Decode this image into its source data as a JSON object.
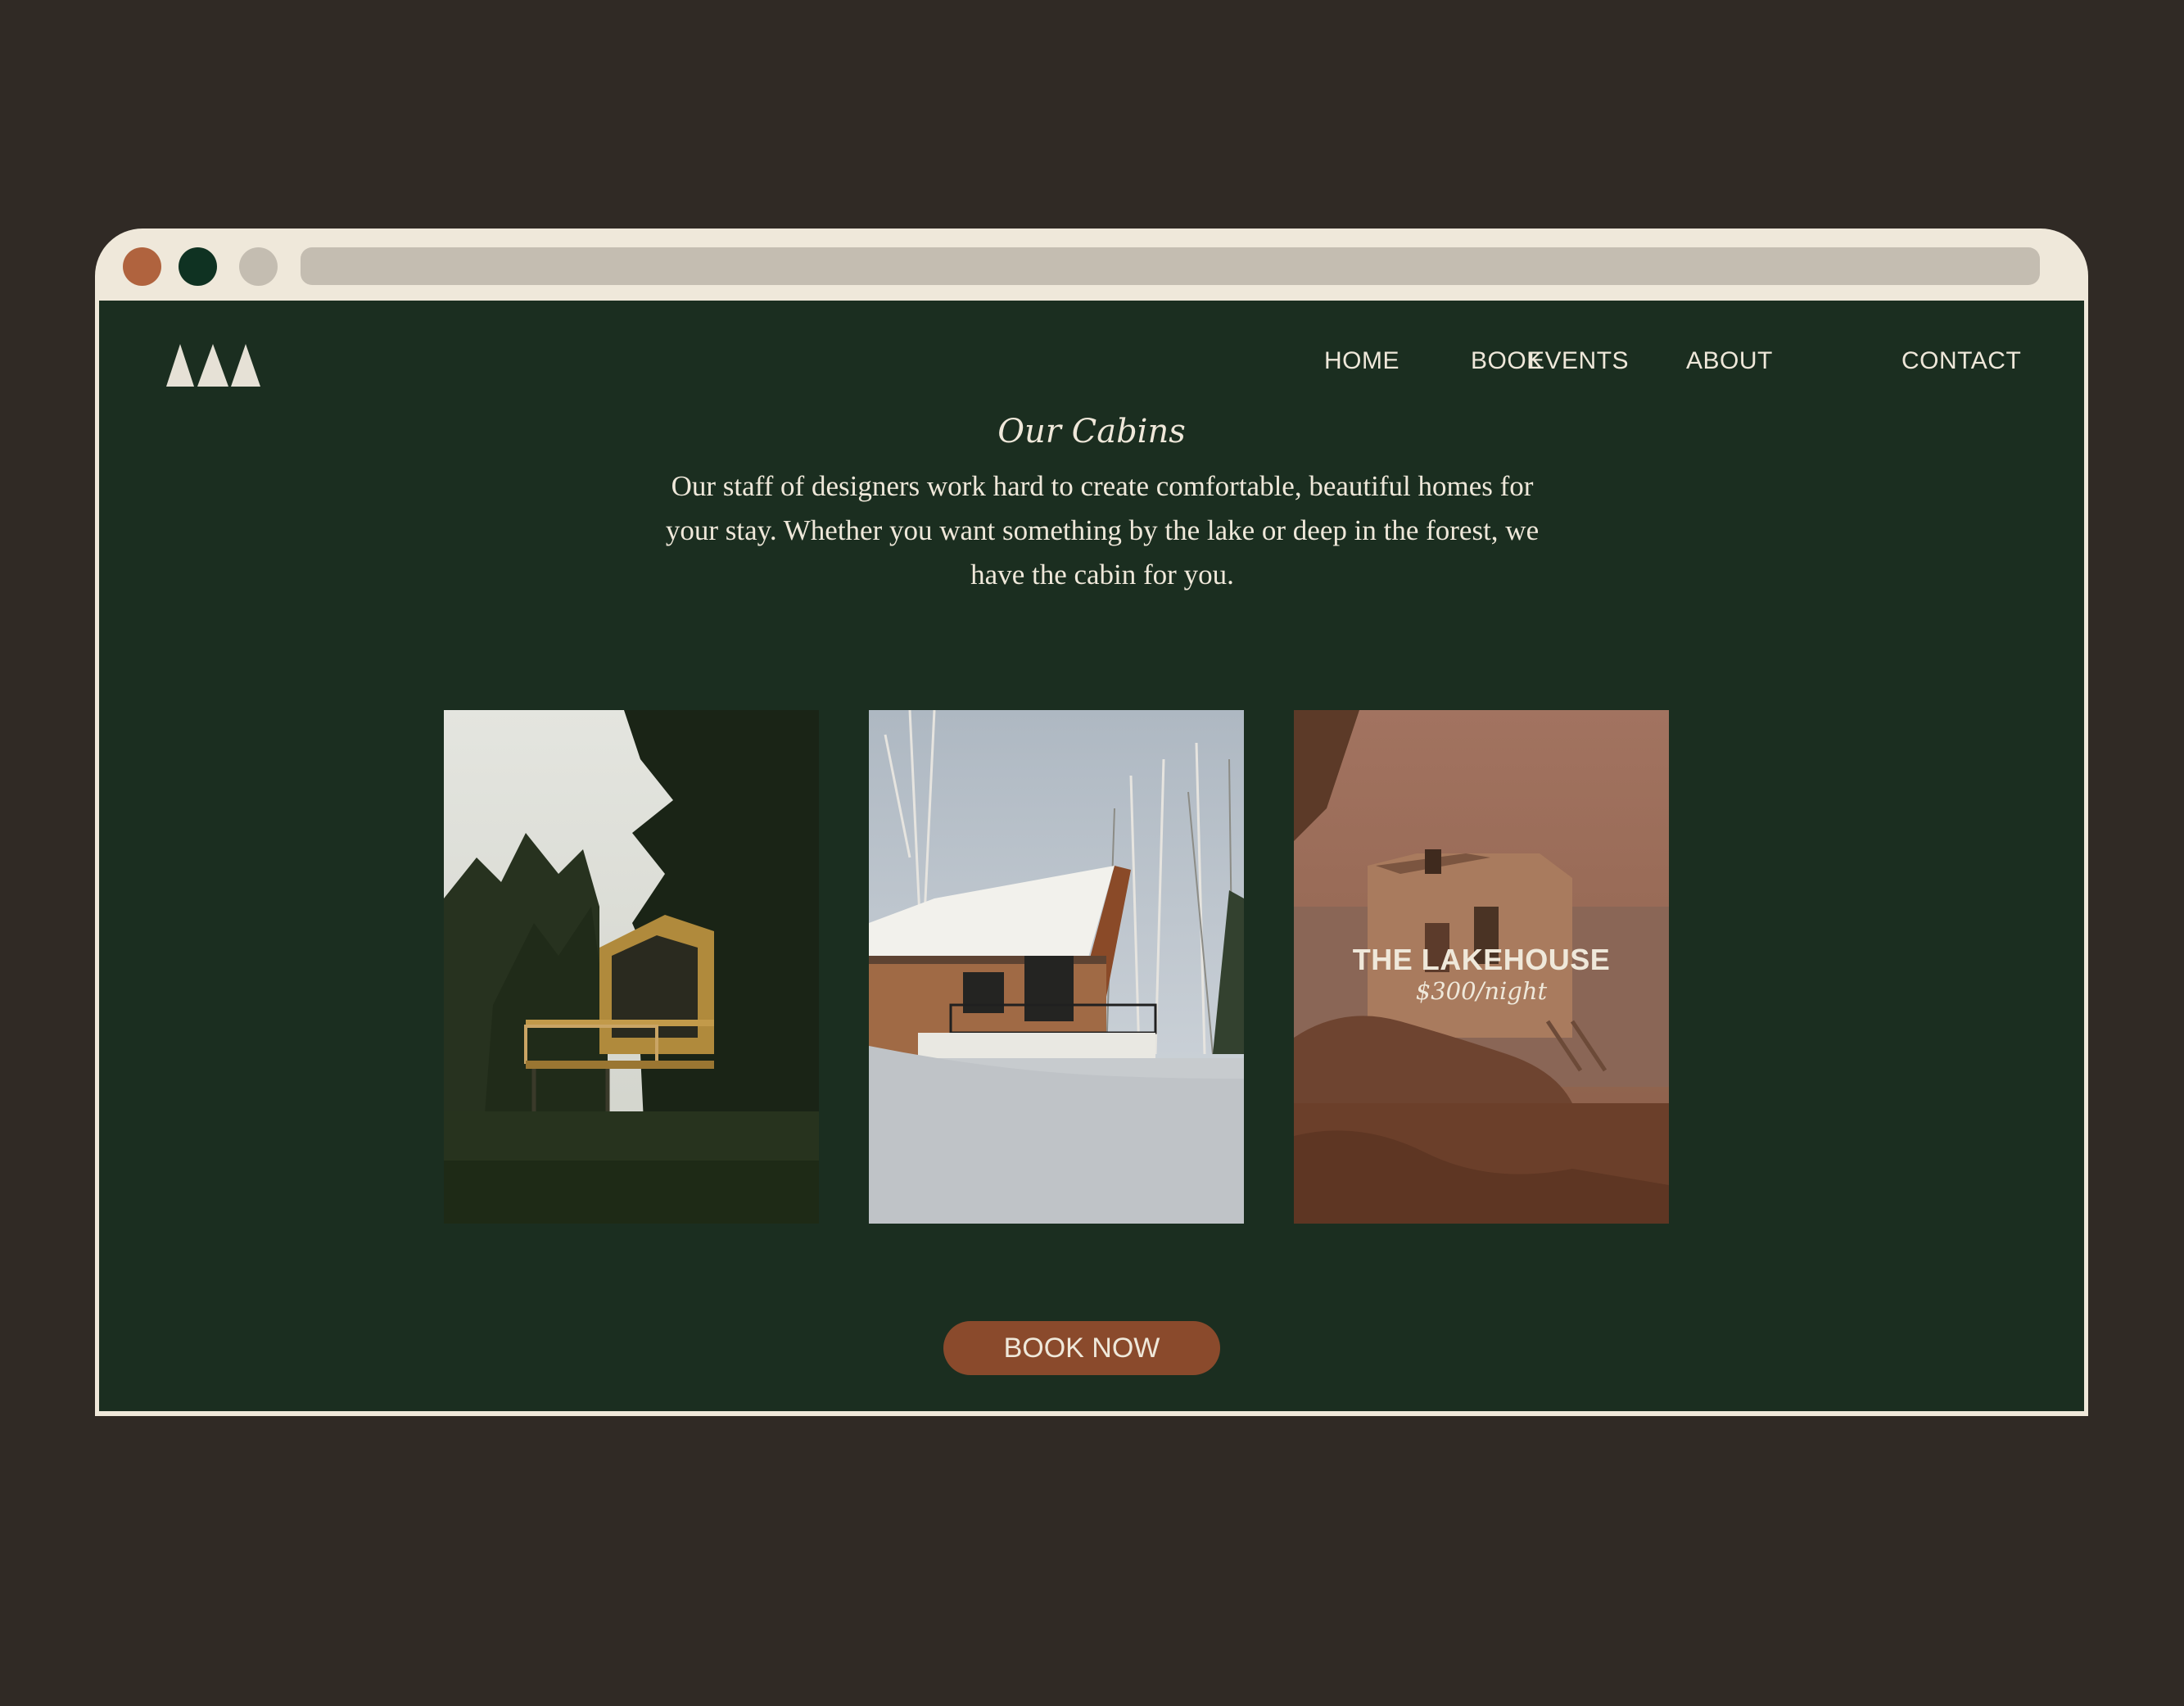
{
  "nav": {
    "items": [
      {
        "label": "HOME"
      },
      {
        "label": "BOOK"
      },
      {
        "label": "EVENTS"
      },
      {
        "label": "ABOUT"
      },
      {
        "label": "CONTACT"
      }
    ]
  },
  "main": {
    "title": "Our Cabins",
    "intro": "Our staff of designers work hard to create comfortable, beautiful homes for your stay. Whether you want something by the lake or deep in the forest, we have the cabin for you.",
    "cards": [
      {
        "image": "forest-cabin-photo"
      },
      {
        "image": "snowy-cabin-photo"
      },
      {
        "image": "lakehouse-photo",
        "title": "THE LAKEHOUSE",
        "price": "$300/night"
      }
    ],
    "cta_label": "BOOK NOW"
  },
  "colors": {
    "page_bg": "#302a25",
    "frame": "#efe8da",
    "site_bg": "#1b2e20",
    "accent": "#8a4a2c",
    "dot_red": "#b0633e",
    "dot_green": "#0f3222",
    "dot_gray": "#c4bdb1"
  },
  "icons": {
    "logo": "three-trees-logo"
  }
}
